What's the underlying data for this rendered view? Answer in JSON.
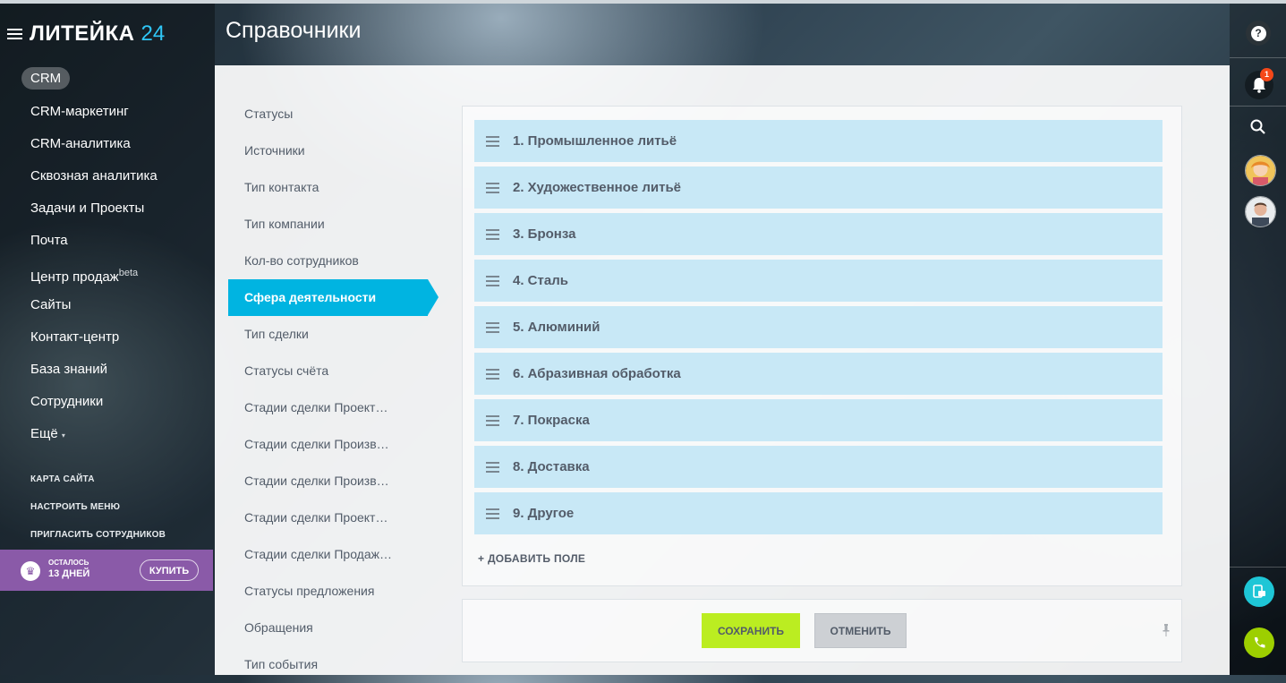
{
  "app": {
    "logo_name": "ЛИТЕЙКА",
    "logo_number": "24",
    "page_title": "Справочники"
  },
  "left_menu": {
    "crm_label": "CRM",
    "items": [
      "CRM-маркетинг",
      "CRM-аналитика",
      "Сквозная аналитика",
      "Задачи и Проекты",
      "Почта",
      "Центр продаж",
      "Сайты",
      "Контакт-центр",
      "База знаний",
      "Сотрудники",
      "Ещё"
    ],
    "beta_label": "beta",
    "more_arrow": "▾",
    "links": [
      "КАРТА САЙТА",
      "НАСТРОИТЬ МЕНЮ",
      "ПРИГЛАСИТЬ СОТРУДНИКОВ"
    ],
    "trial": {
      "line1": "ОСТАЛОСЬ",
      "line2": "13 ДНЕЙ",
      "buy_label": "КУПИТЬ"
    }
  },
  "dict_nav": {
    "items": [
      "Статусы",
      "Источники",
      "Тип контакта",
      "Тип компании",
      "Кол-во сотрудников",
      "Сфера деятельности",
      "Тип сделки",
      "Статусы счёта",
      "Стадии сделки Проект…",
      "Стадии сделки Произв…",
      "Стадии сделки Произв…",
      "Стадии сделки Проект…",
      "Стадии сделки Продаж…",
      "Статусы предложения",
      "Обращения",
      "Тип события"
    ],
    "active_index": 5
  },
  "list": {
    "items": [
      "1. Промышленное литьё",
      "2. Художественное литьё",
      "3. Бронза",
      "4. Сталь",
      "5. Алюминий",
      "6. Абразивная обработка",
      "7. Покраска",
      "8. Доставка",
      "9. Другое"
    ],
    "add_field_label": "+ ДОБАВИТЬ ПОЛЕ"
  },
  "footer": {
    "save_label": "СОХРАНИТЬ",
    "cancel_label": "ОТМЕНИТЬ"
  },
  "right_bar": {
    "help_glyph": "?",
    "notification_count": "1"
  },
  "colors": {
    "accent": "#00b4e1",
    "save": "#bbed21",
    "item_bg": "#c8e8f6",
    "trial_bg": "#8a5aa8",
    "badge": "#f54819",
    "logo_number": "#2fc6f6"
  }
}
